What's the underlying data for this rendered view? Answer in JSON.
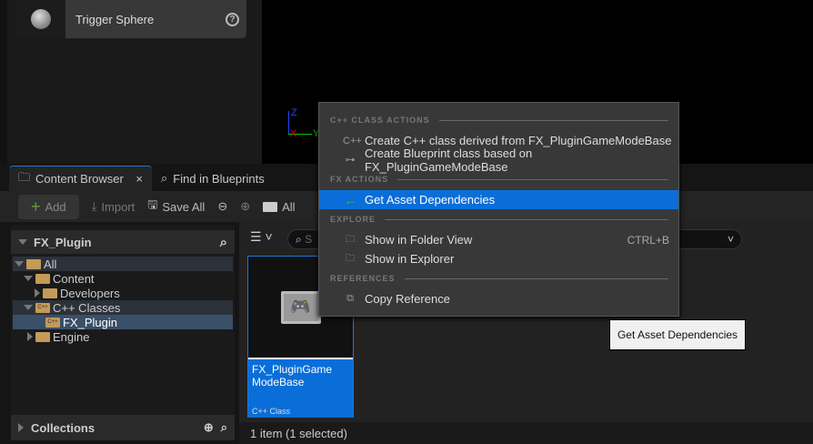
{
  "placement": {
    "card_label": "Trigger Sphere"
  },
  "viewport": {
    "axis_z": "Z",
    "axis_x": "X",
    "axis_y": "Y"
  },
  "tabs": [
    {
      "label": "Content Browser",
      "close": "×"
    },
    {
      "label": "Find in Blueprints"
    }
  ],
  "toolbar": {
    "add": "Add",
    "import": "Import",
    "save_all": "Save All",
    "path": "All"
  },
  "sources": {
    "title": "FX_Plugin",
    "tree": [
      {
        "label": "All"
      },
      {
        "label": "Content"
      },
      {
        "label": "Developers"
      },
      {
        "label": "C++ Classes"
      },
      {
        "label": "FX_Plugin"
      },
      {
        "label": "Engine"
      }
    ],
    "collections": "Collections"
  },
  "search": {
    "placeholder": "S"
  },
  "asset": {
    "name": "FX_PluginGame ModeBase",
    "type": "C++ Class"
  },
  "status": "1 item (1 selected)",
  "menu": {
    "sections": [
      "C++ CLASS ACTIONS",
      "FX ACTIONS",
      "EXPLORE",
      "REFERENCES"
    ],
    "items": [
      {
        "label": "Create C++ class derived from FX_PluginGameModeBase"
      },
      {
        "label": "Create Blueprint class based on FX_PluginGameModeBase"
      },
      {
        "label": "Get Asset Dependencies"
      },
      {
        "label": "Show in Folder View",
        "shortcut": "CTRL+B"
      },
      {
        "label": "Show in Explorer"
      },
      {
        "label": "Copy Reference"
      }
    ]
  },
  "tooltip": "Get Asset Dependencies",
  "colors": {
    "accent": "#0a6ed9",
    "folder": "#c49a58"
  }
}
